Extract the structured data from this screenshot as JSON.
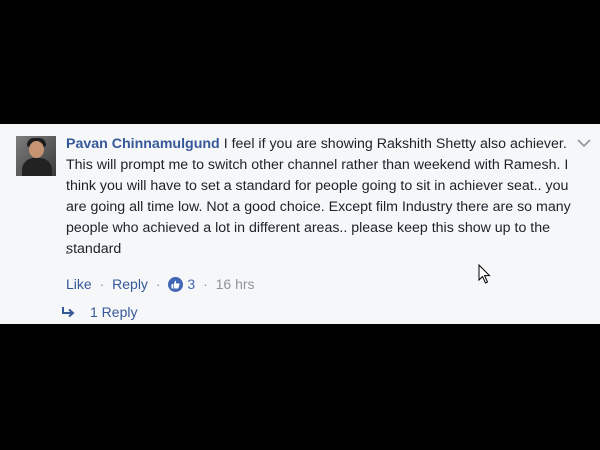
{
  "comment": {
    "author": "Pavan Chinnamulgund",
    "text": "I feel if you are showing Rakshith Shetty also achiever. This will prompt me to switch other channel rather than weekend with Ramesh. I think you will have to set a standard for people going to sit in achiever seat.. you are going all time low. Not a good choice. Except film Industry there are so many people who achieved a lot in different areas.. please keep this show up to the standard",
    "trailing": "."
  },
  "actions": {
    "like_label": "Like",
    "reply_label": "Reply",
    "separator": "·",
    "like_count": "3",
    "time": "16 hrs"
  },
  "replies": {
    "label": "1 Reply"
  },
  "icons": {
    "avatar": "profile-photo",
    "options": "chevron-down-icon",
    "like_badge": "thumbs-up-icon",
    "reply_arrow": "reply-arrow-icon",
    "cursor": "mouse-pointer-icon"
  },
  "colors": {
    "link": "#365899",
    "text": "#1d2129",
    "meta": "#90949c",
    "like_badge": "#4267b2",
    "panel": "#f6f7f9"
  }
}
